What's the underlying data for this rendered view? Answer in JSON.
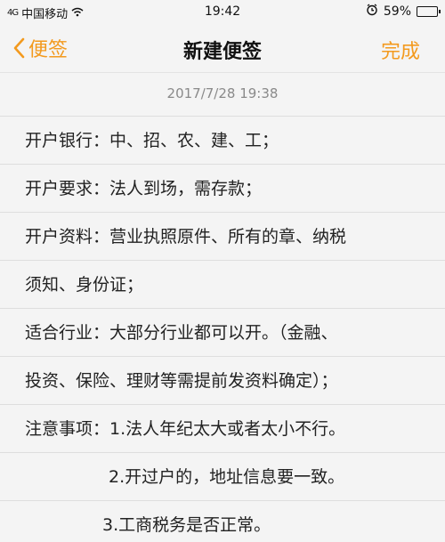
{
  "status": {
    "carrier": "中国移动",
    "signal": "4G",
    "time": "19:42",
    "battery": "59%",
    "battery_level": 0.59
  },
  "nav": {
    "back_label": "便签",
    "title": "新建便签",
    "done_label": "完成"
  },
  "note": {
    "timestamp": "2017/7/28 19:38",
    "lines": [
      "开户银行：中、招、农、建、工；",
      "开户要求：法人到场，需存款；",
      "开户资料：营业执照原件、所有的章、纳税",
      "须知、身份证；",
      "适合行业：大部分行业都可以开。（金融、",
      "投资、保险、理财等需提前发资料确定）；",
      "注意事项：1.法人年纪太大或者太小不行。",
      "2.开过户的，地址信息要一致。",
      "3.工商税务是否正常。"
    ]
  },
  "icons": {
    "back": "chevron-left-icon",
    "alarm": "alarm-icon",
    "wifi": "wifi-icon",
    "battery": "battery-icon"
  }
}
